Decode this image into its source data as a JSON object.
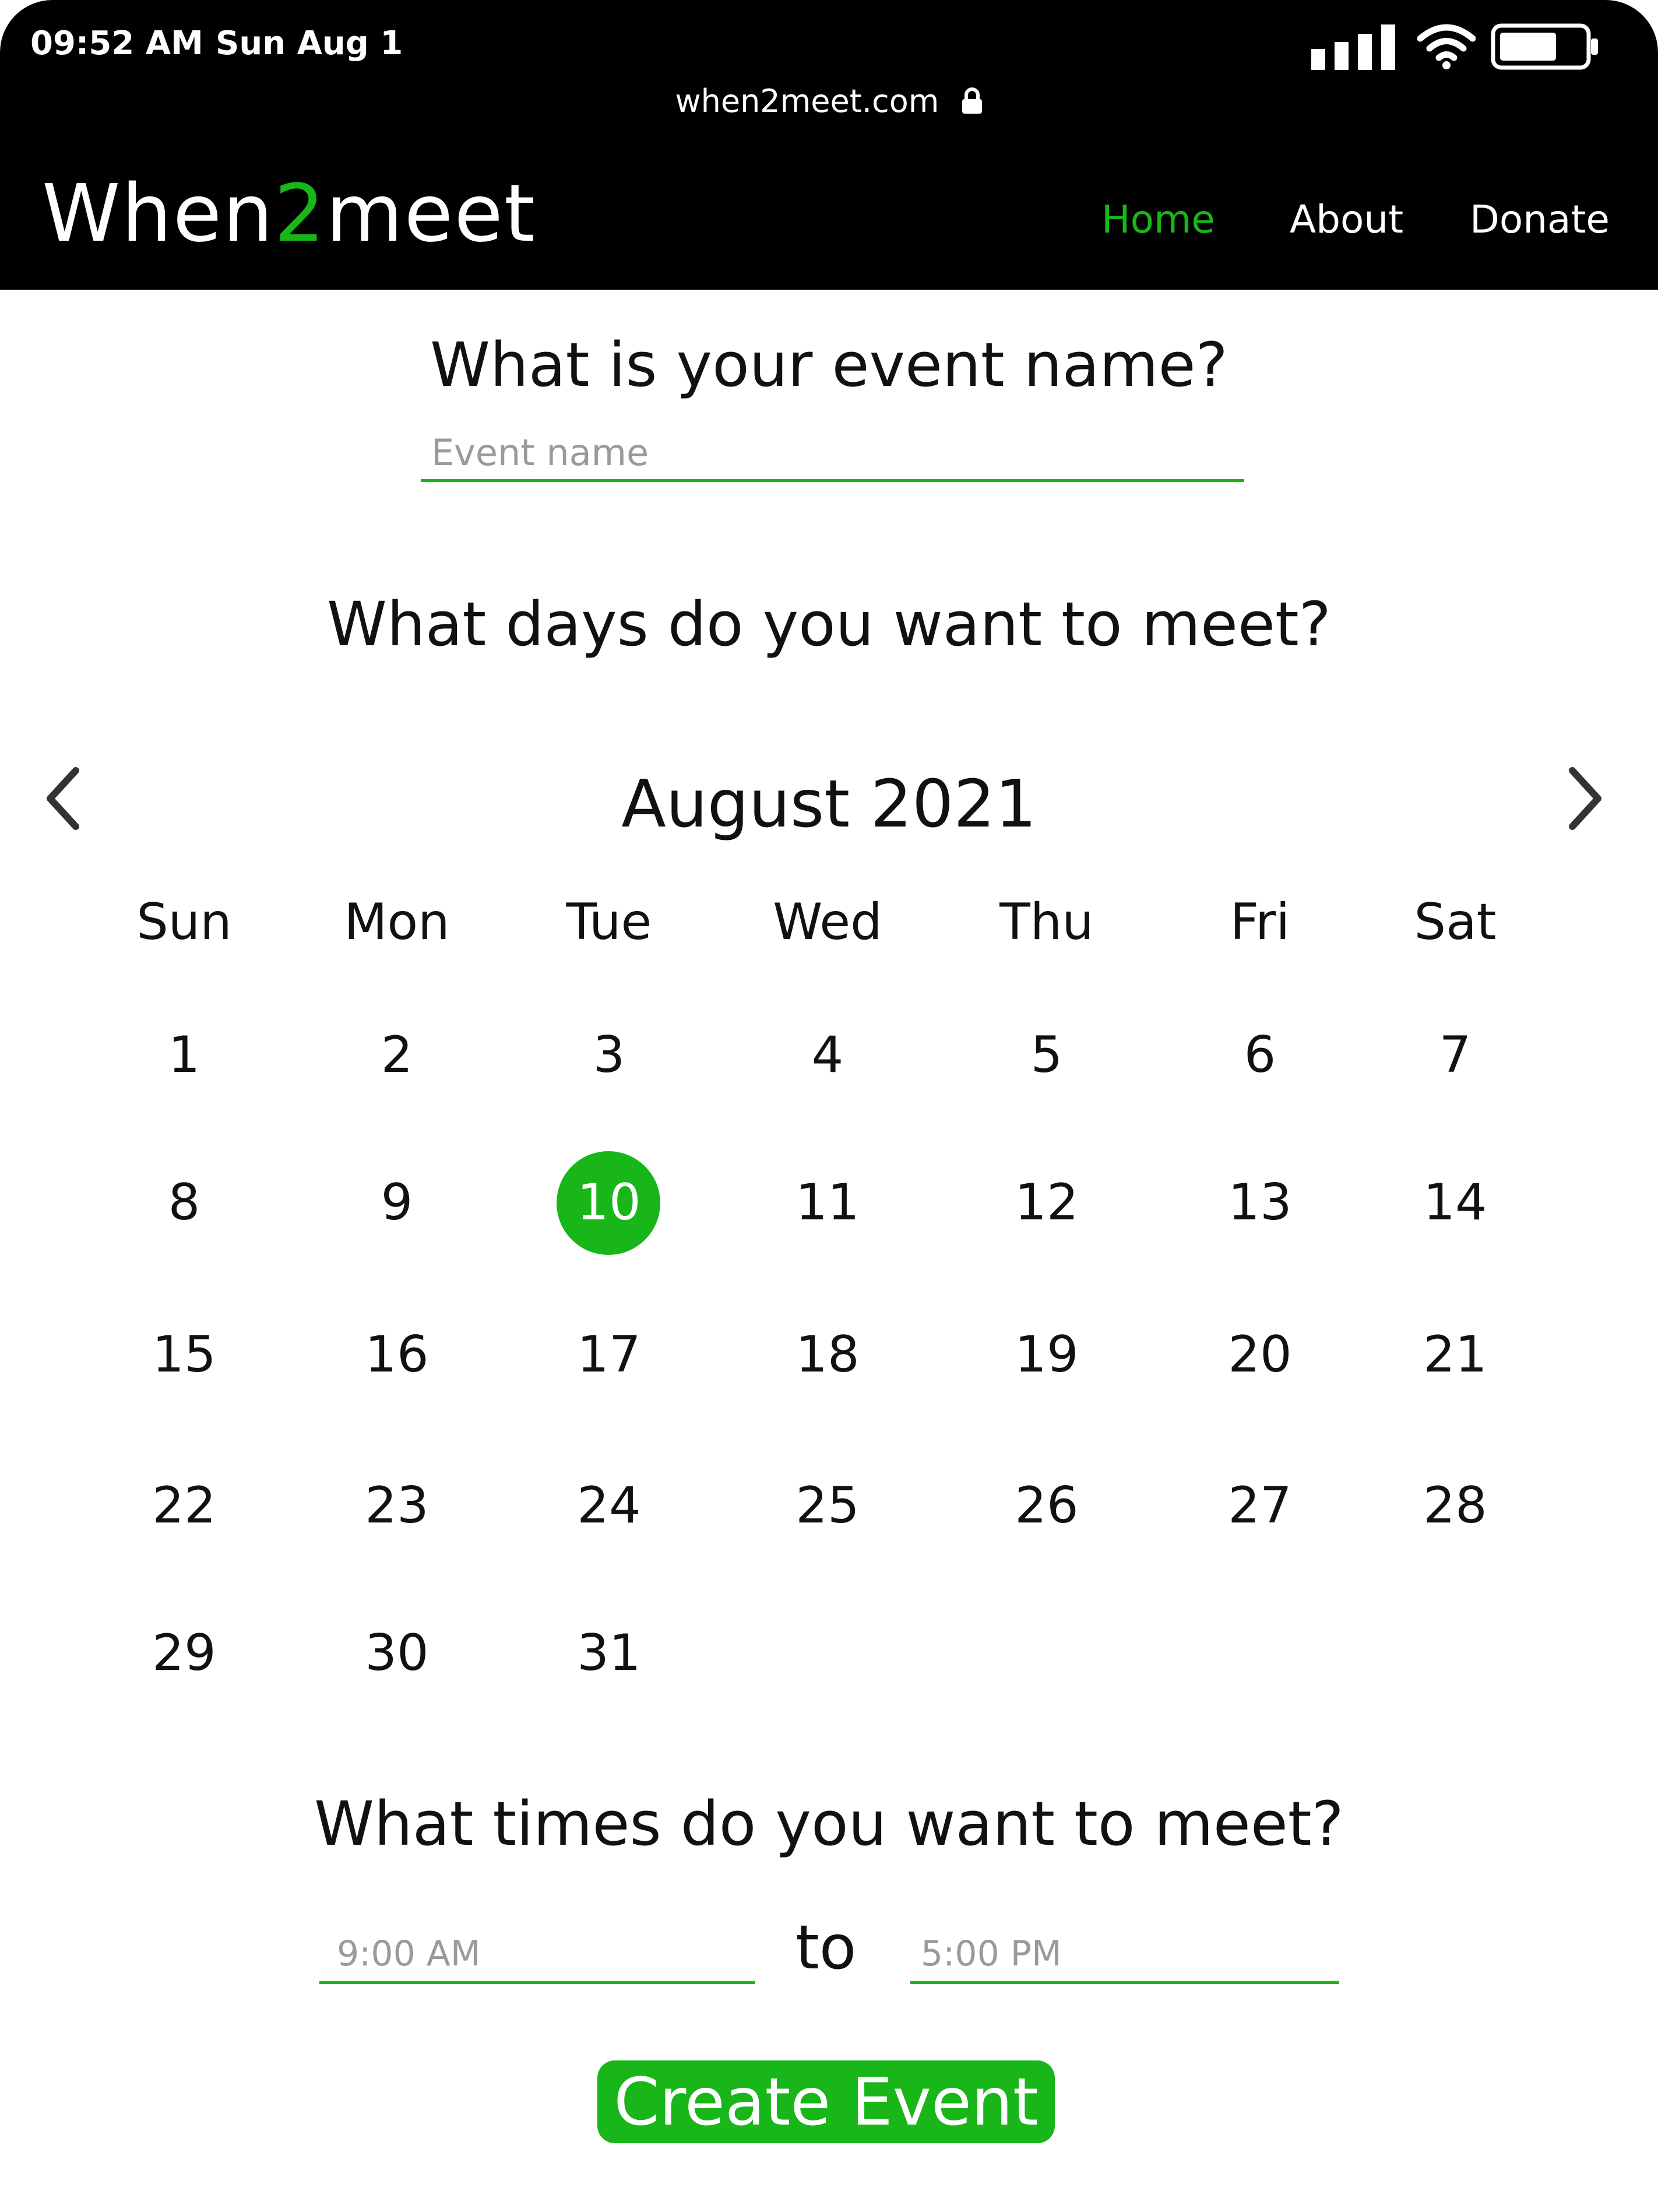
{
  "status_bar": {
    "time": "09:52 AM",
    "date": "Sun Aug 1",
    "url": "when2meet.com"
  },
  "header": {
    "logo_part1": "When",
    "logo_part2": "2",
    "logo_part3": "meet",
    "nav": [
      "Home",
      "About",
      "Donate"
    ],
    "active_nav": "Home"
  },
  "form": {
    "event_heading": "What is your event name?",
    "event_placeholder": "Event name",
    "days_heading": "What days do you want to meet?",
    "times_heading": "What times do you want to meet?",
    "time_from_placeholder": "9:00 AM",
    "to_label": "to",
    "time_to_placeholder": "5:00 PM",
    "create_button": "Create Event"
  },
  "calendar": {
    "month_label": "August 2021",
    "weekdays": [
      "Sun",
      "Mon",
      "Tue",
      "Wed",
      "Thu",
      "Fri",
      "Sat"
    ],
    "weeks": [
      [
        "1",
        "2",
        "3",
        "4",
        "5",
        "6",
        "7"
      ],
      [
        "8",
        "9",
        "10",
        "11",
        "12",
        "13",
        "14"
      ],
      [
        "15",
        "16",
        "17",
        "18",
        "19",
        "20",
        "21"
      ],
      [
        "22",
        "23",
        "24",
        "25",
        "26",
        "27",
        "28"
      ],
      [
        "29",
        "30",
        "31",
        "",
        "",
        "",
        ""
      ]
    ],
    "selected_day": "10"
  },
  "colors": {
    "accent": "#18b618",
    "header_bg": "#000000"
  },
  "icons": [
    "signal-icon",
    "wifi-icon",
    "battery-icon",
    "lock-icon",
    "chevron-left-icon",
    "chevron-right-icon"
  ]
}
